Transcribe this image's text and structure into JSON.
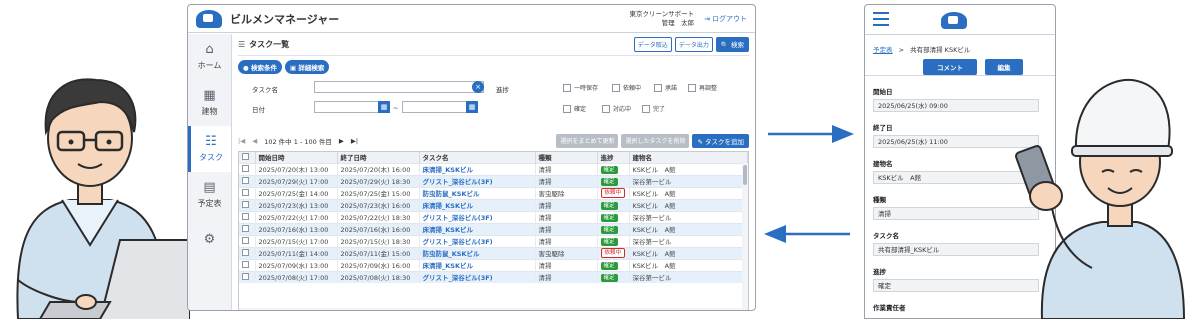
{
  "colors": {
    "accent": "#2a6ec2",
    "confirmed": "#2a9a3c",
    "request": "#d12b2b",
    "row_alt": "#e6f0fb"
  },
  "desktop": {
    "app_title": "ビルメンマネージャー",
    "user_company": "東京クリーンサポート",
    "user_name": "管理　太郎",
    "logout_label": "ログアウト",
    "nav": [
      {
        "label": "ホーム",
        "icon": "home-icon"
      },
      {
        "label": "建物",
        "icon": "building-icon"
      },
      {
        "label": "タスク",
        "icon": "task-icon"
      },
      {
        "label": "予定表",
        "icon": "calendar-icon"
      },
      {
        "label": "",
        "icon": "gear-icon"
      }
    ],
    "page_title": "タスク一覧",
    "import_label": "データ取込",
    "export_label": "データ出力",
    "search_label": "検索",
    "tab_conditions": "検索条件",
    "tab_advanced": "詳細検索",
    "form": {
      "task_name_label": "タスク名",
      "date_label": "日付",
      "range_sep": "~",
      "progress_label": "進捗",
      "checkboxes": [
        "一時保存",
        "依頼中",
        "承諾",
        "再調整",
        "確定",
        "対応中",
        "完了"
      ]
    },
    "pager": {
      "text": "102 件中 1 - 100 件目"
    },
    "bulk_update_label": "選択をまとめて更新",
    "delete_label": "選択したタスクを削除",
    "add_label": "タスクを追加",
    "columns": [
      "開始日時",
      "終了日時",
      "タスク名",
      "種類",
      "進捗",
      "建物名"
    ],
    "rows": [
      {
        "start": "2025/07/20(木) 13:00",
        "end": "2025/07/20(木) 16:00",
        "name": "床清掃_KSKビル",
        "type": "清掃",
        "status": "確定",
        "building": "KSKビル　A館"
      },
      {
        "start": "2025/07/29(火) 17:00",
        "end": "2025/07/29(火) 18:30",
        "name": "グリスト_深谷ビル(3F)",
        "type": "清掃",
        "status": "確定",
        "building": "深谷第一ビル"
      },
      {
        "start": "2025/07/25(金) 14:00",
        "end": "2025/07/25(金) 15:00",
        "name": "防虫防鼠_KSKビル",
        "type": "害虫駆除",
        "status": "依頼中",
        "building": "KSKビル　A館"
      },
      {
        "start": "2025/07/23(水) 13:00",
        "end": "2025/07/23(水) 16:00",
        "name": "床清掃_KSKビル",
        "type": "清掃",
        "status": "確定",
        "building": "KSKビル　A館"
      },
      {
        "start": "2025/07/22(火) 17:00",
        "end": "2025/07/22(火) 18:30",
        "name": "グリスト_深谷ビル(3F)",
        "type": "清掃",
        "status": "確定",
        "building": "深谷第一ビル"
      },
      {
        "start": "2025/07/16(水) 13:00",
        "end": "2025/07/16(水) 16:00",
        "name": "床清掃_KSKビル",
        "type": "清掃",
        "status": "確定",
        "building": "KSKビル　A館"
      },
      {
        "start": "2025/07/15(火) 17:00",
        "end": "2025/07/15(火) 18:30",
        "name": "グリスト_深谷ビル(3F)",
        "type": "清掃",
        "status": "確定",
        "building": "深谷第一ビル"
      },
      {
        "start": "2025/07/11(金) 14:00",
        "end": "2025/07/11(金) 15:00",
        "name": "防虫防鼠_KSKビル",
        "type": "害虫駆除",
        "status": "依頼中",
        "building": "KSKビル　A館"
      },
      {
        "start": "2025/07/09(水) 13:00",
        "end": "2025/07/09(水) 16:00",
        "name": "床清掃_KSKビル",
        "type": "清掃",
        "status": "確定",
        "building": "KSKビル　A館"
      },
      {
        "start": "2025/07/08(火) 17:00",
        "end": "2025/07/08(火) 18:30",
        "name": "グリスト_深谷ビル(3F)",
        "type": "清掃",
        "status": "確定",
        "building": "深谷第一ビル"
      }
    ]
  },
  "mobile": {
    "breadcrumb_link": "予定表",
    "breadcrumb_sep": ">",
    "breadcrumb_current": "共有部清掃 KSKビル",
    "comment_label": "コメント",
    "edit_label": "編集",
    "fields": [
      {
        "label": "開始日",
        "value": "2025/06/25(水) 09:00"
      },
      {
        "label": "終了日",
        "value": "2025/06/25(水) 11:00"
      },
      {
        "label": "建物名",
        "value": "KSKビル　A館"
      },
      {
        "label": "種類",
        "value": "清掃"
      },
      {
        "label": "タスク名",
        "value": "共有部清掃_KSKビル"
      },
      {
        "label": "進捗",
        "value": "確定"
      },
      {
        "label": "作業責任者",
        "value": ""
      }
    ]
  }
}
